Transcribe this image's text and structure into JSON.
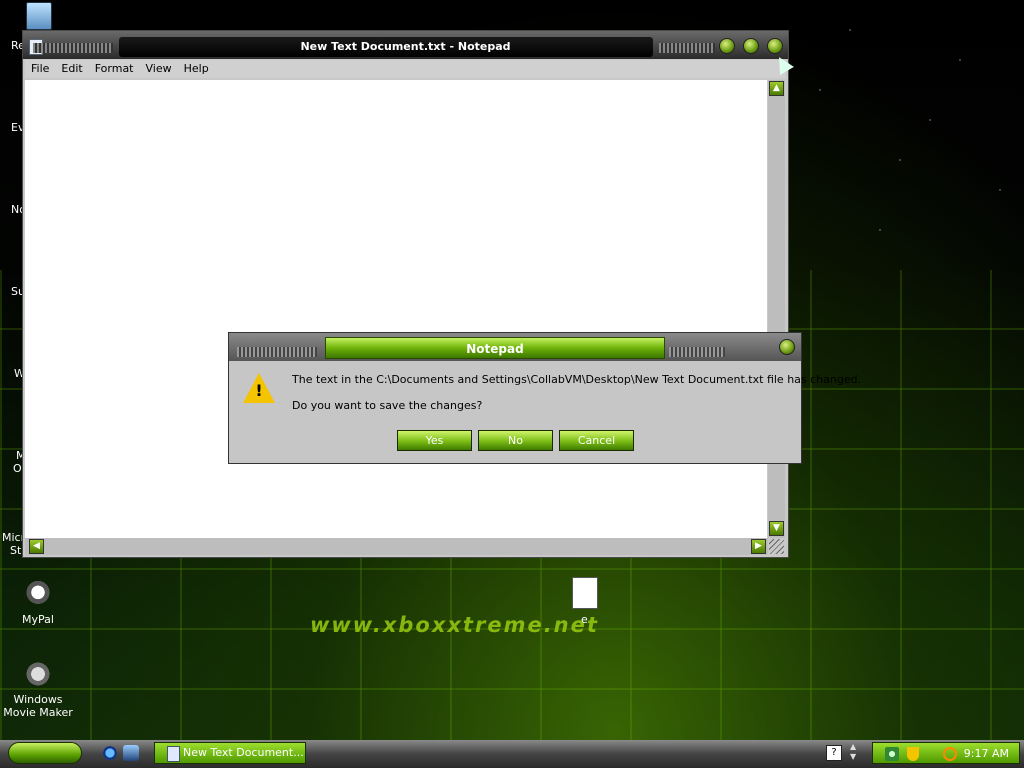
{
  "desktop": {
    "left_edge_labels": [
      "Re",
      "Ev",
      "No",
      "Su",
      "W",
      "M",
      "O",
      "Micro",
      "Stu"
    ],
    "icons": [
      {
        "label": "MyPal",
        "icon": "raccoon-shortcut-icon"
      },
      {
        "label": "Windows Movie Maker",
        "icon": "film-reel-shortcut-icon"
      },
      {
        "label": "e",
        "icon": "text-file-icon"
      }
    ],
    "wallpaper_text": "www.xboxxtreme.net"
  },
  "notepad": {
    "title": "New Text Document.txt - Notepad",
    "menu": [
      "File",
      "Edit",
      "Format",
      "View",
      "Help"
    ],
    "content": ""
  },
  "dialog": {
    "title": "Notepad",
    "message": "The text in the C:\\Documents and Settings\\CollabVM\\Desktop\\New Text Document.txt file has changed.",
    "question": "Do you want to save the changes?",
    "buttons": {
      "yes": "Yes",
      "no": "No",
      "cancel": "Cancel"
    }
  },
  "taskbar": {
    "task_label": "New Text Document...",
    "clock": "9:17 AM"
  },
  "colors": {
    "accent_green": "#6fb30a",
    "title_dark": "#000000",
    "window_gray": "#c6c6c6"
  }
}
